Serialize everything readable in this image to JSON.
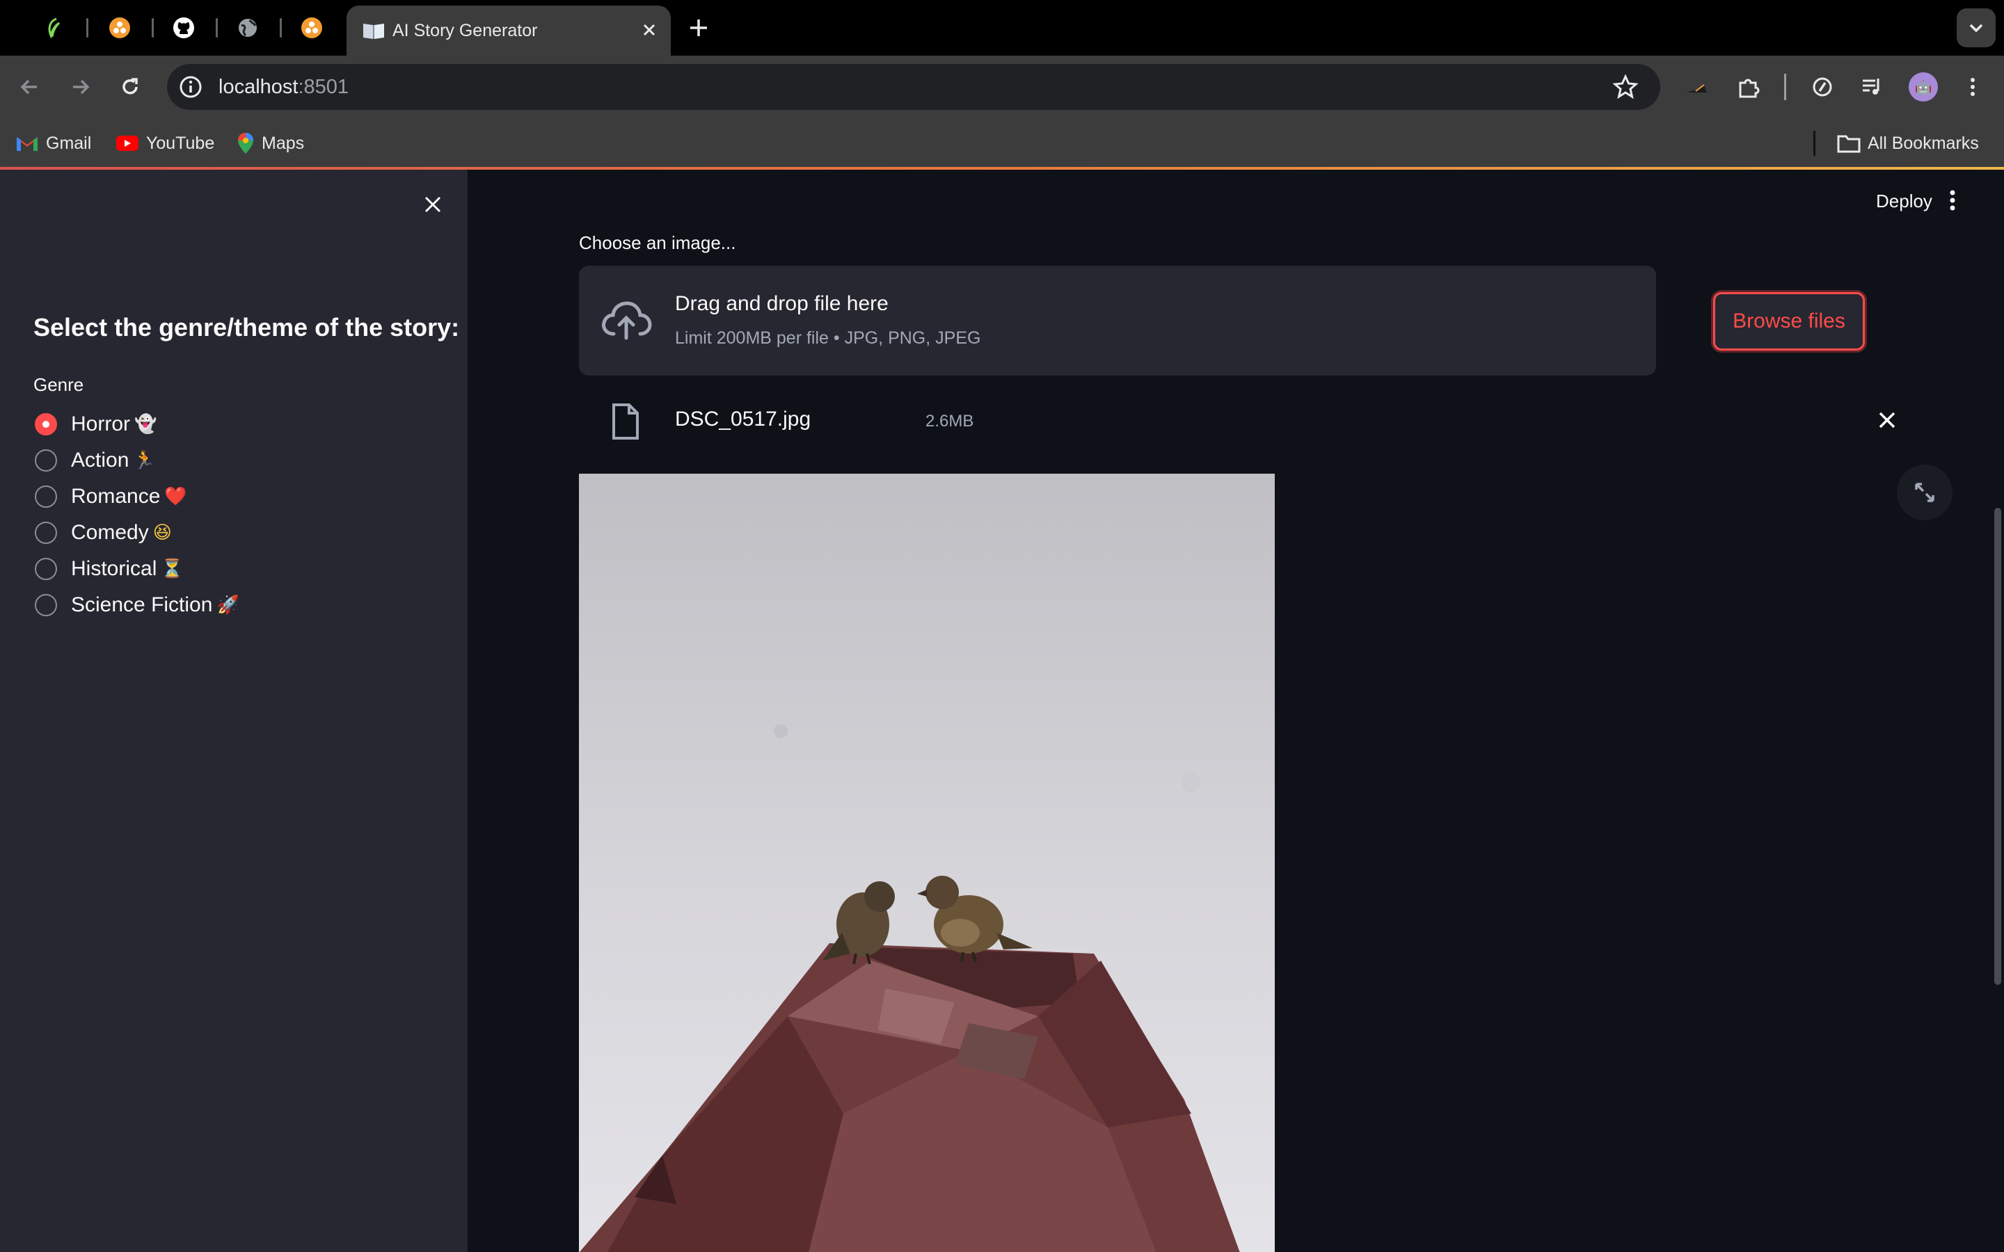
{
  "browser": {
    "active_tab_title": "AI Story Generator",
    "url_host": "localhost",
    "url_port": ":8501",
    "bookmarks": [
      "Gmail",
      "YouTube",
      "Maps"
    ],
    "all_bookmarks": "All Bookmarks"
  },
  "sidebar": {
    "heading": "Select the genre/theme of the story:",
    "radio_label": "Genre",
    "options": [
      {
        "label": "Horror",
        "emoji": "👻",
        "selected": true
      },
      {
        "label": "Action",
        "emoji": "🏃",
        "selected": false
      },
      {
        "label": "Romance",
        "emoji": "❤️",
        "selected": false
      },
      {
        "label": "Comedy",
        "emoji": "😆",
        "selected": false
      },
      {
        "label": "Historical",
        "emoji": "⏳",
        "selected": false
      },
      {
        "label": "Science Fiction",
        "emoji": "🚀",
        "selected": false
      }
    ]
  },
  "header": {
    "deploy_label": "Deploy"
  },
  "uploader": {
    "label": "Choose an image...",
    "drop_title": "Drag and drop file here",
    "drop_limit": "Limit 200MB per file • JPG, PNG, JPEG",
    "browse_label": "Browse files",
    "file_name": "DSC_0517.jpg",
    "file_size": "2.6MB"
  },
  "colors": {
    "accent": "#ff4b4b",
    "sidebar_bg": "#262730",
    "main_bg": "#0e1117"
  },
  "icons": [
    "chrome-tab-icons",
    "github-icon",
    "book-icon",
    "cloud-upload-icon",
    "file-icon",
    "close-icon",
    "fullscreen-icon",
    "kebab-menu-icon"
  ]
}
